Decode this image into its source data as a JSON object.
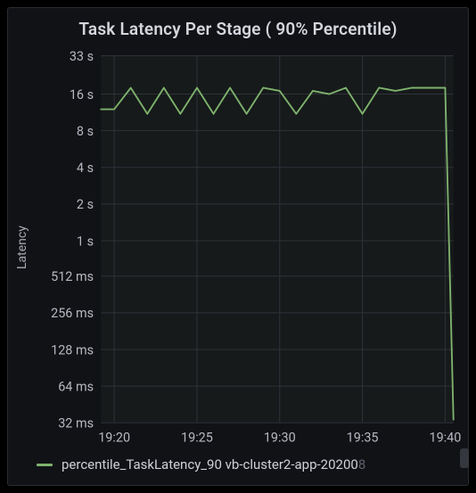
{
  "title": "Task Latency Per Stage ( 90% Percentile)",
  "ylabel": "Latency",
  "legend_series_label": "percentile_TaskLatency_90 vb-cluster2-app-20200",
  "legend_series_label_trunc": "8",
  "chart_data": {
    "type": "line",
    "xlabel": "",
    "ylabel": "Latency",
    "x_ticks": [
      "19:20",
      "19:25",
      "19:30",
      "19:35",
      "19:40"
    ],
    "y_ticks": [
      "32 ms",
      "64 ms",
      "128 ms",
      "256 ms",
      "512 ms",
      "1 s",
      "2 s",
      "4 s",
      "8 s",
      "16 s",
      "33 s"
    ],
    "y_scale": "log",
    "ylim_ms": [
      32,
      33000
    ],
    "xlim_minutes": [
      1159.2,
      1180.5
    ],
    "series": [
      {
        "name": "percentile_TaskLatency_90 vb-cluster2-app-202008",
        "color": "#7EB26D",
        "points": [
          {
            "t": "19:19.2",
            "ms": 12000
          },
          {
            "t": "19:20",
            "ms": 12000
          },
          {
            "t": "19:21",
            "ms": 18000
          },
          {
            "t": "19:22",
            "ms": 11000
          },
          {
            "t": "19:23",
            "ms": 18000
          },
          {
            "t": "19:24",
            "ms": 11000
          },
          {
            "t": "19:25",
            "ms": 18000
          },
          {
            "t": "19:26",
            "ms": 11000
          },
          {
            "t": "19:27",
            "ms": 18000
          },
          {
            "t": "19:28",
            "ms": 11000
          },
          {
            "t": "19:29",
            "ms": 18000
          },
          {
            "t": "19:30",
            "ms": 17000
          },
          {
            "t": "19:31",
            "ms": 11000
          },
          {
            "t": "19:32",
            "ms": 17000
          },
          {
            "t": "19:33",
            "ms": 16000
          },
          {
            "t": "19:34",
            "ms": 18000
          },
          {
            "t": "19:35",
            "ms": 11000
          },
          {
            "t": "19:36",
            "ms": 18000
          },
          {
            "t": "19:37",
            "ms": 17000
          },
          {
            "t": "19:38",
            "ms": 18000
          },
          {
            "t": "19:39",
            "ms": 18000
          },
          {
            "t": "19:40",
            "ms": 18000
          },
          {
            "t": "19:40.5",
            "ms": 34
          }
        ]
      }
    ]
  }
}
